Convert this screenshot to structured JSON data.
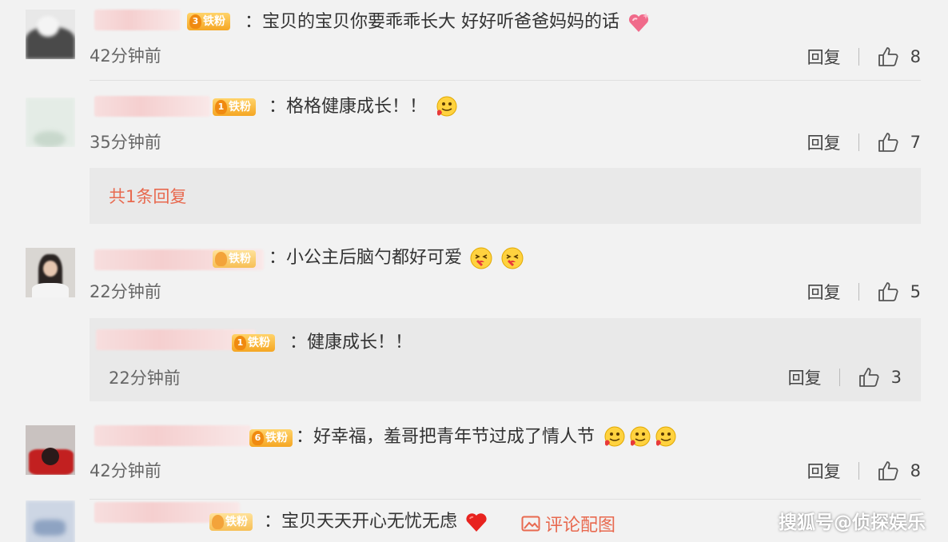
{
  "comments": [
    {
      "badge": "铁粉",
      "level": "3",
      "text": "：宝贝的宝贝你要乖乖长大 好好听爸爸妈妈的话",
      "emoji": [
        "heart-sparkle"
      ],
      "time": "42分钟前",
      "reply": "回复",
      "likes": "8"
    },
    {
      "badge": "铁粉",
      "level": "1",
      "text": "：格格健康成长！！",
      "emoji": [
        "tongue-face"
      ],
      "time": "35分钟前",
      "reply": "回复",
      "likes": "7",
      "more_replies": "共1条回复"
    },
    {
      "badge": "铁粉",
      "level": "",
      "text": "：小公主后脑勺都好可爱",
      "emoji": [
        "kiss-face",
        "kiss-face"
      ],
      "time": "22分钟前",
      "reply": "回复",
      "likes": "5",
      "sub_reply": {
        "badge": "铁粉",
        "level": "1",
        "text": "：健康成长！！",
        "time": "22分钟前",
        "reply": "回复",
        "likes": "3"
      }
    },
    {
      "badge": "铁粉",
      "level": "6",
      "text": "：好幸福，羞哥把青年节过成了情人节",
      "emoji": [
        "tongue-face",
        "tongue-face",
        "tongue-face"
      ],
      "time": "42分钟前",
      "reply": "回复",
      "likes": "8"
    },
    {
      "badge": "铁粉",
      "level": "",
      "text": "：宝贝天天开心无忧无虑",
      "emoji": [
        "red-heart"
      ],
      "image_link": "评论配图"
    }
  ],
  "watermark": "搜狐号@侦探娱乐",
  "colors": {
    "accent": "#e8694f",
    "badge": "#f5a623",
    "background": "#f2f2f2"
  }
}
